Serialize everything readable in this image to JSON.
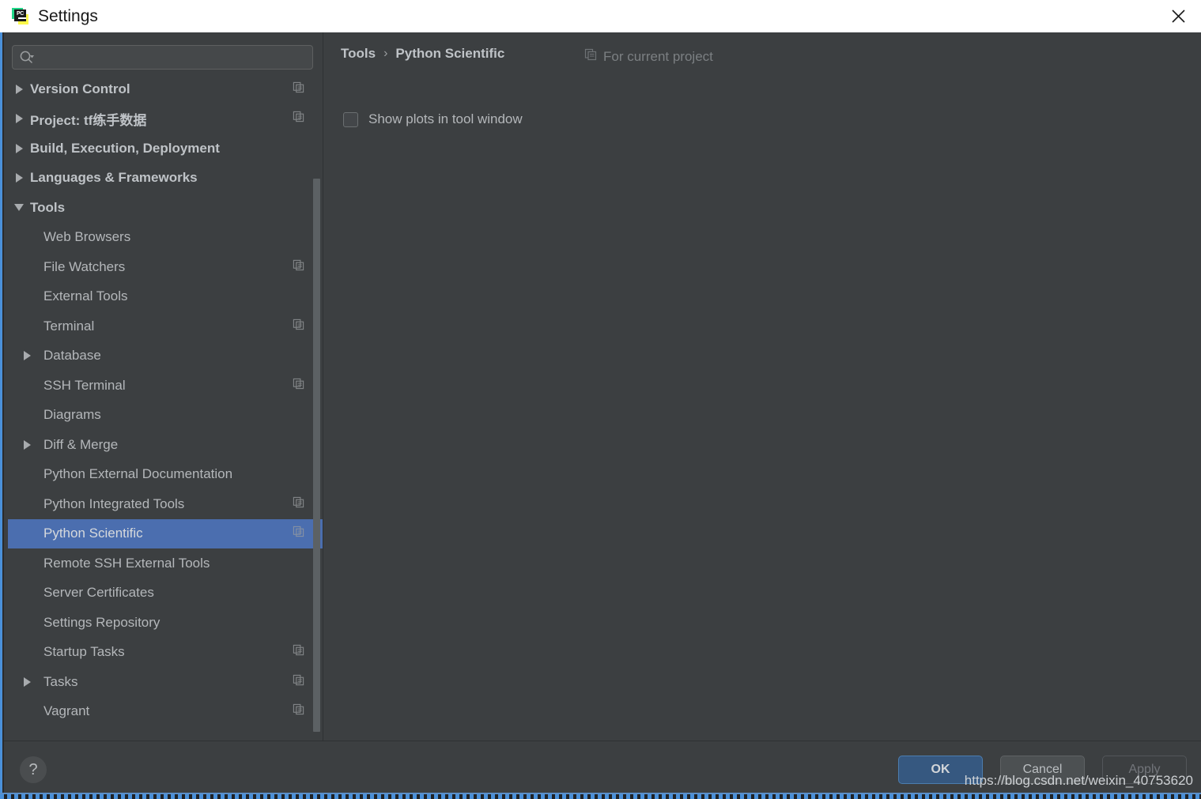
{
  "window": {
    "title": "Settings",
    "app_icon": "pycharm-logo",
    "close_label": "×",
    "accent_blue": "#4a90d9",
    "selection_blue": "#4b6eaf",
    "background": "#3c3f41"
  },
  "search": {
    "placeholder": "",
    "value": "",
    "icon": "search-icon"
  },
  "sidebar": {
    "items": [
      {
        "label": "Version Control",
        "level": 0,
        "arrow": "right",
        "copy_icon": true,
        "selected": false
      },
      {
        "label": "Project: tf练手数据",
        "level": 0,
        "arrow": "right",
        "copy_icon": true,
        "selected": false
      },
      {
        "label": "Build, Execution, Deployment",
        "level": 0,
        "arrow": "right",
        "copy_icon": false,
        "selected": false
      },
      {
        "label": "Languages & Frameworks",
        "level": 0,
        "arrow": "right",
        "copy_icon": false,
        "selected": false
      },
      {
        "label": "Tools",
        "level": 0,
        "arrow": "down",
        "copy_icon": false,
        "selected": false
      },
      {
        "label": "Web Browsers",
        "level": 1,
        "arrow": "none",
        "copy_icon": false,
        "selected": false
      },
      {
        "label": "File Watchers",
        "level": 1,
        "arrow": "none",
        "copy_icon": true,
        "selected": false
      },
      {
        "label": "External Tools",
        "level": 1,
        "arrow": "none",
        "copy_icon": false,
        "selected": false
      },
      {
        "label": "Terminal",
        "level": 1,
        "arrow": "none",
        "copy_icon": true,
        "selected": false
      },
      {
        "label": "Database",
        "level": 1,
        "arrow": "right",
        "copy_icon": false,
        "selected": false
      },
      {
        "label": "SSH Terminal",
        "level": 1,
        "arrow": "none",
        "copy_icon": true,
        "selected": false
      },
      {
        "label": "Diagrams",
        "level": 1,
        "arrow": "none",
        "copy_icon": false,
        "selected": false
      },
      {
        "label": "Diff & Merge",
        "level": 1,
        "arrow": "right",
        "copy_icon": false,
        "selected": false
      },
      {
        "label": "Python External Documentation",
        "level": 1,
        "arrow": "none",
        "copy_icon": false,
        "selected": false
      },
      {
        "label": "Python Integrated Tools",
        "level": 1,
        "arrow": "none",
        "copy_icon": true,
        "selected": false
      },
      {
        "label": "Python Scientific",
        "level": 1,
        "arrow": "none",
        "copy_icon": true,
        "selected": true
      },
      {
        "label": "Remote SSH External Tools",
        "level": 1,
        "arrow": "none",
        "copy_icon": false,
        "selected": false
      },
      {
        "label": "Server Certificates",
        "level": 1,
        "arrow": "none",
        "copy_icon": false,
        "selected": false
      },
      {
        "label": "Settings Repository",
        "level": 1,
        "arrow": "none",
        "copy_icon": false,
        "selected": false
      },
      {
        "label": "Startup Tasks",
        "level": 1,
        "arrow": "none",
        "copy_icon": true,
        "selected": false
      },
      {
        "label": "Tasks",
        "level": 1,
        "arrow": "right",
        "copy_icon": true,
        "selected": false
      },
      {
        "label": "Vagrant",
        "level": 1,
        "arrow": "none",
        "copy_icon": true,
        "selected": false
      }
    ]
  },
  "content": {
    "breadcrumb": {
      "parent": "Tools",
      "separator": "›",
      "current": "Python Scientific"
    },
    "scope": {
      "icon": "copy-icon",
      "label": "For current project"
    },
    "options": [
      {
        "label": "Show plots in tool window",
        "checked": false
      }
    ]
  },
  "footer": {
    "help_label": "?",
    "ok_label": "OK",
    "cancel_label": "Cancel",
    "apply_label": "Apply",
    "apply_enabled": false,
    "watermark": "https://blog.csdn.net/weixin_40753620"
  }
}
